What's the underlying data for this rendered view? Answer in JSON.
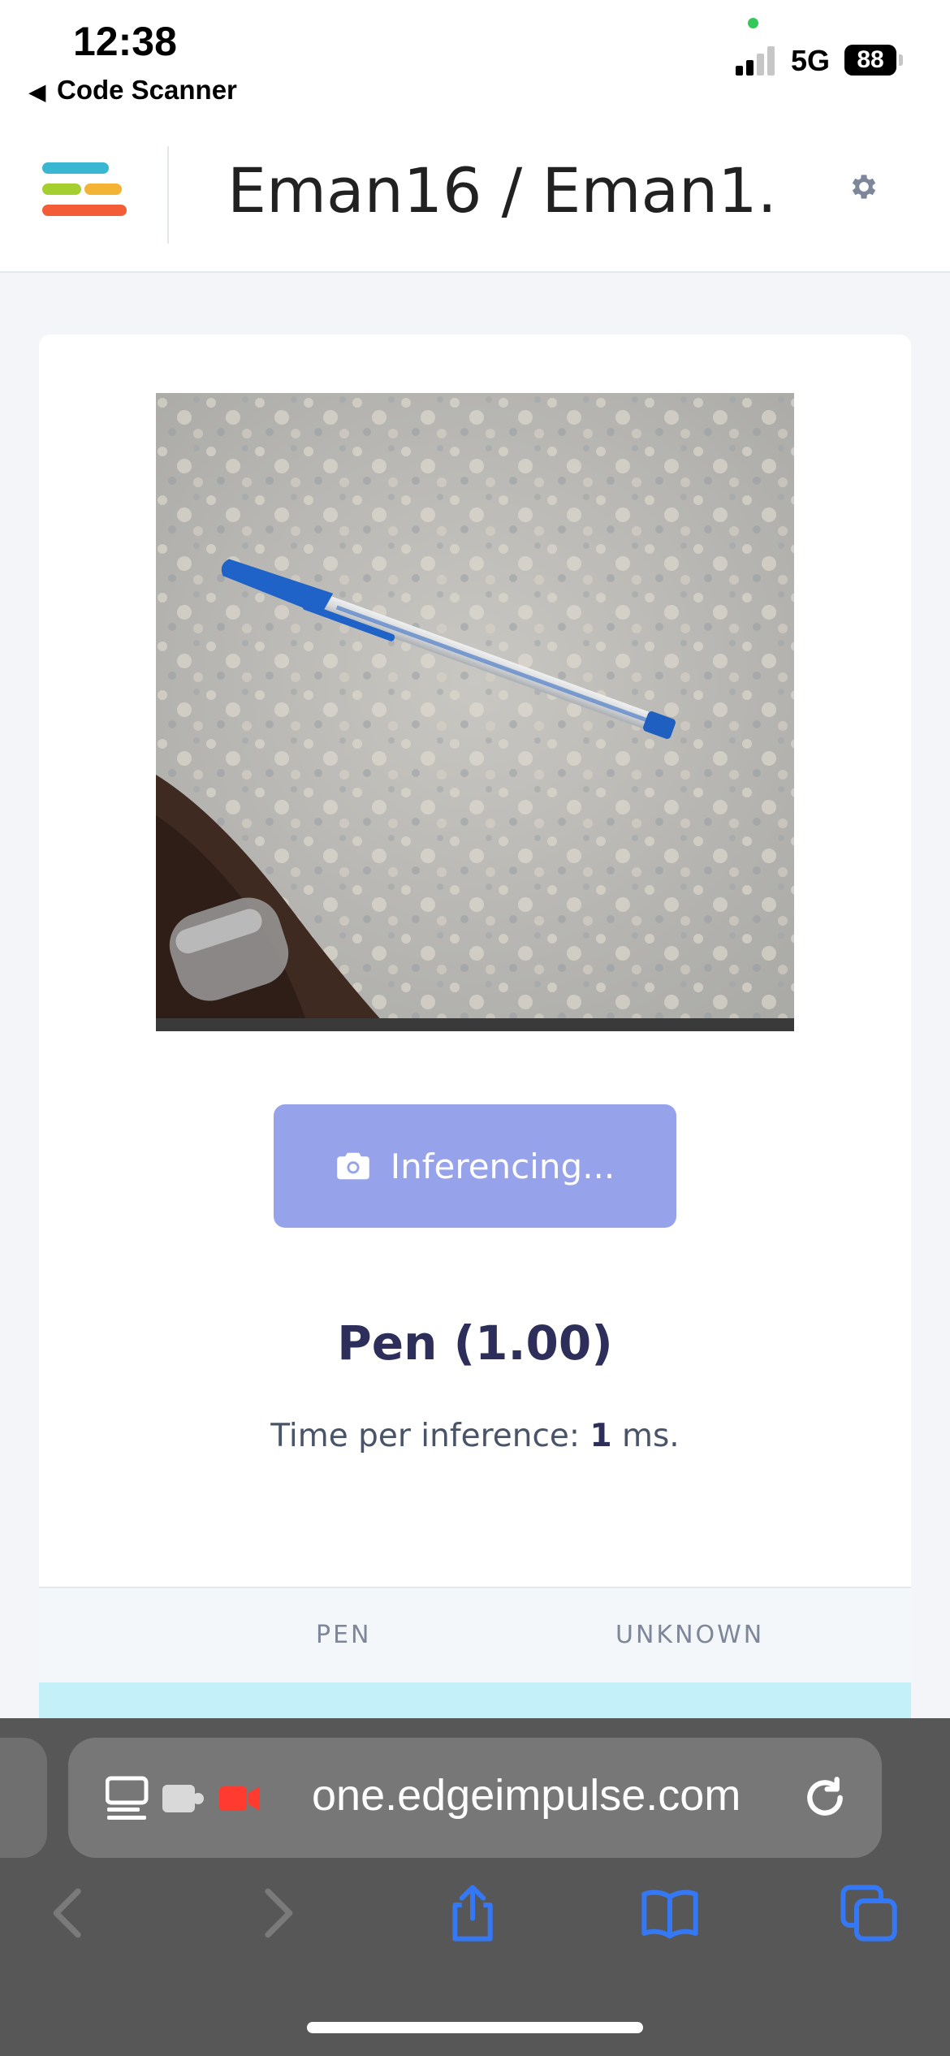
{
  "status_bar": {
    "time": "12:38",
    "back_app": "Code Scanner",
    "network": "5G",
    "battery": "88"
  },
  "header": {
    "title": "Eman16 / Eman1...",
    "settings_icon": "gear-icon"
  },
  "card": {
    "photo_subject": "pen on granite countertop",
    "button_label": "Inferencing...",
    "button_icon": "camera-icon",
    "result": "Pen (1.00)",
    "timing_prefix": "Time per inference: ",
    "timing_value": "1",
    "timing_suffix": " ms.",
    "table_headers": [
      "PEN",
      "UNKNOWN"
    ]
  },
  "browser": {
    "url": "one.edgeimpulse.com"
  },
  "colors": {
    "button": "#96a3ea",
    "result_text": "#2d2f5a",
    "row_highlight": "#c4f1f9",
    "ios_blue": "#3478f6"
  }
}
